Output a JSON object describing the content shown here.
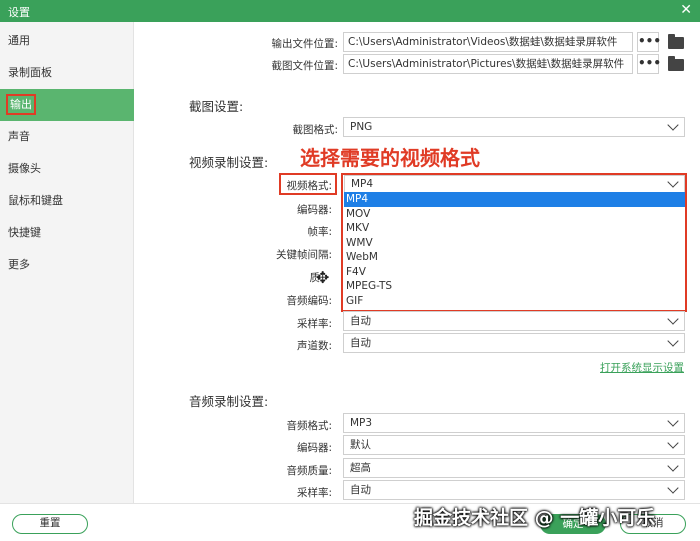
{
  "window": {
    "title": "设置",
    "close_icon": "close-icon"
  },
  "sidebar": {
    "items": [
      {
        "label": "通用",
        "active": false
      },
      {
        "label": "录制面板",
        "active": false
      },
      {
        "label": "输出",
        "active": true
      },
      {
        "label": "声音",
        "active": false
      },
      {
        "label": "摄像头",
        "active": false
      },
      {
        "label": "鼠标和键盘",
        "active": false
      },
      {
        "label": "快捷键",
        "active": false
      },
      {
        "label": "更多",
        "active": false
      }
    ]
  },
  "output": {
    "file_location_label": "输出文件位置:",
    "file_location_value": "C:\\Users\\Administrator\\Videos\\数据蛙\\数据蛙录屏软件",
    "shot_location_label": "截图文件位置:",
    "shot_location_value": "C:\\Users\\Administrator\\Pictures\\数据蛙\\数据蛙录屏软件",
    "more_button": "•••"
  },
  "screenshot": {
    "section": "截图设置:",
    "format_label": "截图格式:",
    "format_value": "PNG"
  },
  "video": {
    "section": "视频录制设置:",
    "annotation": "选择需要的视频格式",
    "format_label": "视频格式:",
    "format_value": "MP4",
    "encoder_label": "编码器:",
    "fps_label": "帧率:",
    "keyframe_label": "关键帧间隔:",
    "quality_label": "质",
    "audio_codec_label": "音频编码:",
    "sample_rate_label": "采样率:",
    "sample_rate_value": "自动",
    "channels_label": "声道数:",
    "channels_value": "自动",
    "options": [
      "MP4",
      "MOV",
      "MKV",
      "WMV",
      "WebM",
      "F4V",
      "MPEG-TS",
      "GIF"
    ],
    "open_system_display": "打开系统显示设置"
  },
  "audio": {
    "section": "音频录制设置:",
    "format_label": "音频格式:",
    "format_value": "MP3",
    "encoder_label": "编码器:",
    "encoder_value": "默认",
    "quality_label": "音频质量:",
    "quality_value": "超高",
    "sample_rate_label": "采样率:",
    "sample_rate_value": "自动"
  },
  "footer": {
    "reset": "重置",
    "ok": "确定",
    "cancel": "取消"
  },
  "watermark": "掘金技术社区 @ 一罐小可乐",
  "colors": {
    "accent": "#3aa15a",
    "highlight": "#e03b25",
    "selection": "#1e7fe6"
  }
}
